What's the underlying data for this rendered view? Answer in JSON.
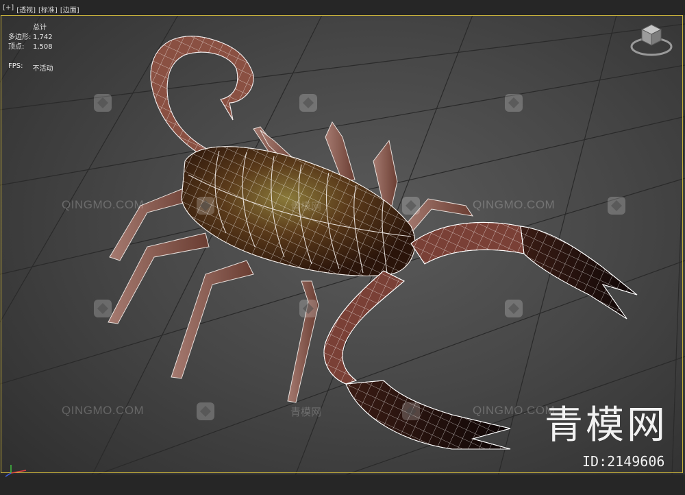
{
  "viewport_menu": {
    "plus": "[+]",
    "view": "[透视]",
    "shading": "[标准]",
    "mode": "[边面]"
  },
  "stats": {
    "header": "总计",
    "polygons_label": "多边形:",
    "polygons_value": "1,742",
    "vertices_label": "顶点:",
    "vertices_value": "1,508",
    "fps_label": "FPS:",
    "fps_value": "不活动"
  },
  "watermarks": {
    "latin": "QINGMO.COM",
    "chinese": "青模网"
  },
  "brand": {
    "logo_text": "青模网",
    "id_text": "ID:2149606"
  },
  "colors": {
    "viewport_border": "#c9b23a",
    "background": "#4a4a4a",
    "wireframe": "#ffffff"
  },
  "icons": {
    "viewcube": "viewcube-icon",
    "axis": "axis-tripod-icon",
    "watermark": "qingmo-logo-icon"
  }
}
